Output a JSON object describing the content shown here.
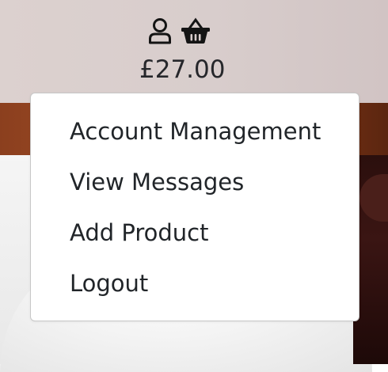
{
  "header": {
    "icons": [
      "user-icon",
      "basket-icon"
    ],
    "cart_total": "£27.00"
  },
  "dropdown": {
    "items": [
      {
        "label": "Account Management"
      },
      {
        "label": "View Messages"
      },
      {
        "label": "Add Product"
      },
      {
        "label": "Logout"
      }
    ]
  },
  "colors": {
    "header_bg": "#d8cdcc",
    "text": "#212529",
    "hero_band": "#a24e27",
    "hero_dark": "#2b0f0d"
  }
}
